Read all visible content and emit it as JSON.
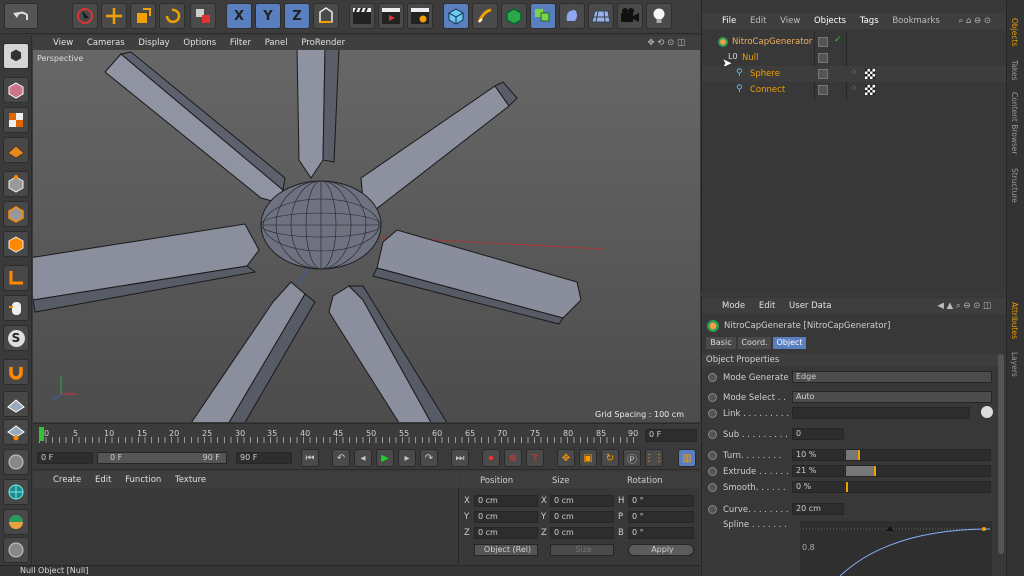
{
  "viewport": {
    "menu": [
      "View",
      "Cameras",
      "Display",
      "Options",
      "Filter",
      "Panel",
      "ProRender"
    ],
    "camera_label": "Perspective",
    "grid_spacing": "Grid Spacing : 100 cm"
  },
  "timeline": {
    "ticks": [
      "0",
      "5",
      "10",
      "15",
      "20",
      "25",
      "30",
      "35",
      "40",
      "45",
      "50",
      "55",
      "60",
      "65",
      "70",
      "75",
      "80",
      "85",
      "90"
    ],
    "current_frame_field": "0 F",
    "start_field": "0 F",
    "range_start": "0 F",
    "range_end": "90 F",
    "end_field": "90 F"
  },
  "material_panel": {
    "menu": [
      "Create",
      "Edit",
      "Function",
      "Texture"
    ]
  },
  "coords_panel": {
    "headers": [
      "Position",
      "Size",
      "Rotation"
    ],
    "rows": [
      {
        "axis": "X",
        "pos": "0 cm",
        "size_axis": "X",
        "size": "0 cm",
        "rot_axis": "H",
        "rot": "0 °"
      },
      {
        "axis": "Y",
        "pos": "0 cm",
        "size_axis": "Y",
        "size": "0 cm",
        "rot_axis": "P",
        "rot": "0 °"
      },
      {
        "axis": "Z",
        "pos": "0 cm",
        "size_axis": "Z",
        "size": "0 cm",
        "rot_axis": "B",
        "rot": "0 °"
      }
    ],
    "mode_select": "Object (Rel)",
    "size_select": "Size",
    "apply_label": "Apply"
  },
  "status_bar": "Null Object [Null]",
  "objects_panel": {
    "menu": [
      "File",
      "Edit",
      "View",
      "Objects",
      "Tags",
      "Bookmarks"
    ],
    "tree": [
      {
        "name": "NitroCapGenerator",
        "indent": 0
      },
      {
        "name": "Null",
        "indent": 1
      },
      {
        "name": "Sphere",
        "indent": 2
      },
      {
        "name": "Connect",
        "indent": 2
      }
    ]
  },
  "side_tabs_top": [
    "Objects",
    "Takes",
    "Content Browser",
    "Structure"
  ],
  "side_tabs_bottom": [
    "Attributes",
    "Layers"
  ],
  "attributes_panel": {
    "menu": [
      "Mode",
      "Edit",
      "User Data"
    ],
    "object_title": "NitroCapGenerate [NitroCapGenerator]",
    "tabs": [
      "Basic",
      "Coord.",
      "Object"
    ],
    "section": "Object Properties",
    "mode_generate_label": "Mode Generate",
    "mode_generate_value": "Edge",
    "mode_select_label": "Mode Select . .",
    "mode_select_value": "Auto",
    "link_label": "Link . . . . . . . . .",
    "sub_label": "Sub . . . . . . . . .",
    "sub_value": "0",
    "turn_label": "Turn. . . . . . . .",
    "turn_value": "10 %",
    "turn_fraction": 0.1,
    "extrude_label": "Extrude . . . . . .",
    "extrude_value": "21 %",
    "extrude_fraction": 0.21,
    "smooth_label": "Smooth. . . . . .",
    "smooth_value": "0 %",
    "smooth_fraction": 0.0,
    "curve_label": "Curve. . . . . . . .",
    "curve_value": "20 cm",
    "spline_label": "Spline . . . . . . .",
    "spline_tick": "0.8"
  }
}
